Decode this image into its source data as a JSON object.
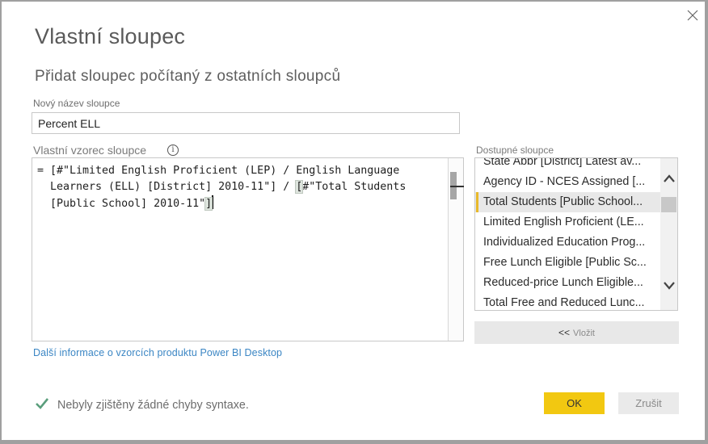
{
  "dialog": {
    "title": "Vlastní sloupec",
    "subtitle": "Přidat sloupec počítaný z ostatních sloupců",
    "close_icon": "close-icon"
  },
  "name_field": {
    "label": "Nový název sloupce",
    "value": "Percent ELL"
  },
  "formula": {
    "label": "Vlastní vzorec sloupce",
    "info_icon": "info-icon",
    "line1": "= [#\"Limited English Proficient (LEP) / English Language",
    "line2_a": "  Learners (ELL) [District] 2010-11\"] / ",
    "line2_bracket": "[",
    "line2_b": "#\"Total Students",
    "line3_a": "  [Public School] 2010-11\"",
    "line3_bracket": "]"
  },
  "help_link": "Další informace o vzorcích produktu Power BI Desktop",
  "available_columns": {
    "label": "Dostupné sloupce",
    "items": [
      {
        "label": "State Abbr [District] Latest av...",
        "selected": false
      },
      {
        "label": "Agency ID - NCES Assigned [...",
        "selected": false
      },
      {
        "label": "Total Students [Public School...",
        "selected": true
      },
      {
        "label": "Limited English Proficient (LE...",
        "selected": false
      },
      {
        "label": "Individualized Education Prog...",
        "selected": false
      },
      {
        "label": "Free Lunch Eligible [Public Sc...",
        "selected": false
      },
      {
        "label": "Reduced-price Lunch Eligible...",
        "selected": false
      },
      {
        "label": "Total Free and Reduced Lunc...",
        "selected": false
      }
    ],
    "insert_arrows": "<<",
    "insert_label": "Vložit"
  },
  "status": {
    "icon": "check-icon",
    "text": "Nebyly zjištěny žádné chyby syntaxe.",
    "color": "#5a9e7c"
  },
  "buttons": {
    "ok": "OK",
    "cancel": "Zrušit",
    "ok_color": "#f2c811"
  }
}
